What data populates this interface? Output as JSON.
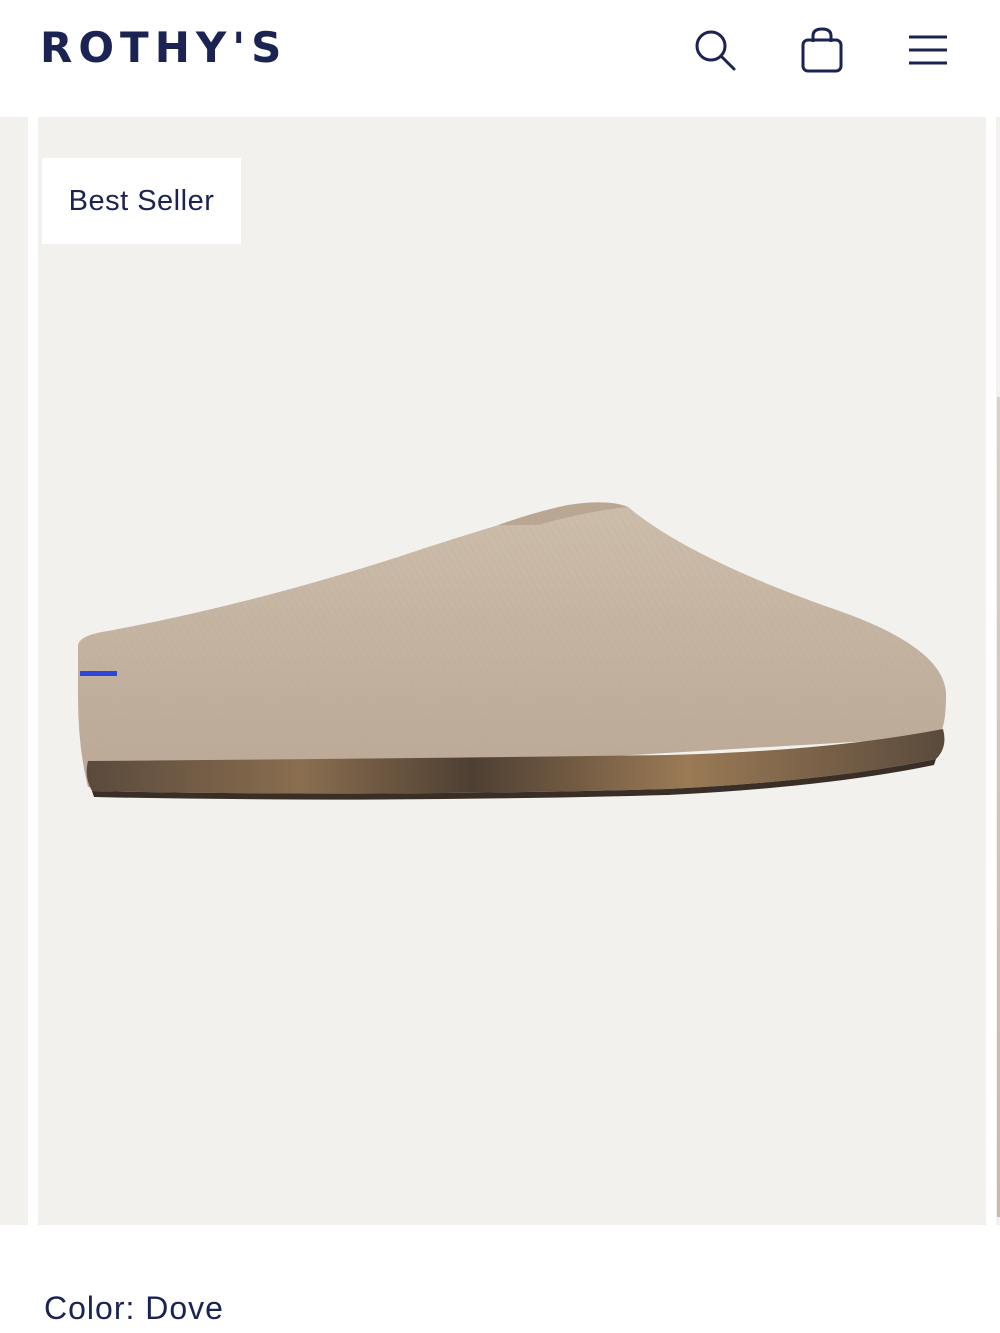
{
  "header": {
    "logo": "ROTHY'S",
    "icons": {
      "search": "search-icon",
      "bag": "shopping-bag-icon",
      "menu": "hamburger-menu-icon"
    }
  },
  "product": {
    "badge": "Best Seller",
    "color_label": "Color: Dove",
    "image": "product-clog-image"
  },
  "colors": {
    "brand_navy": "#1b2352",
    "image_background": "#f2f1ee",
    "shoe_knit": "#c7b6a4",
    "accent_blue": "#2a47d6"
  }
}
